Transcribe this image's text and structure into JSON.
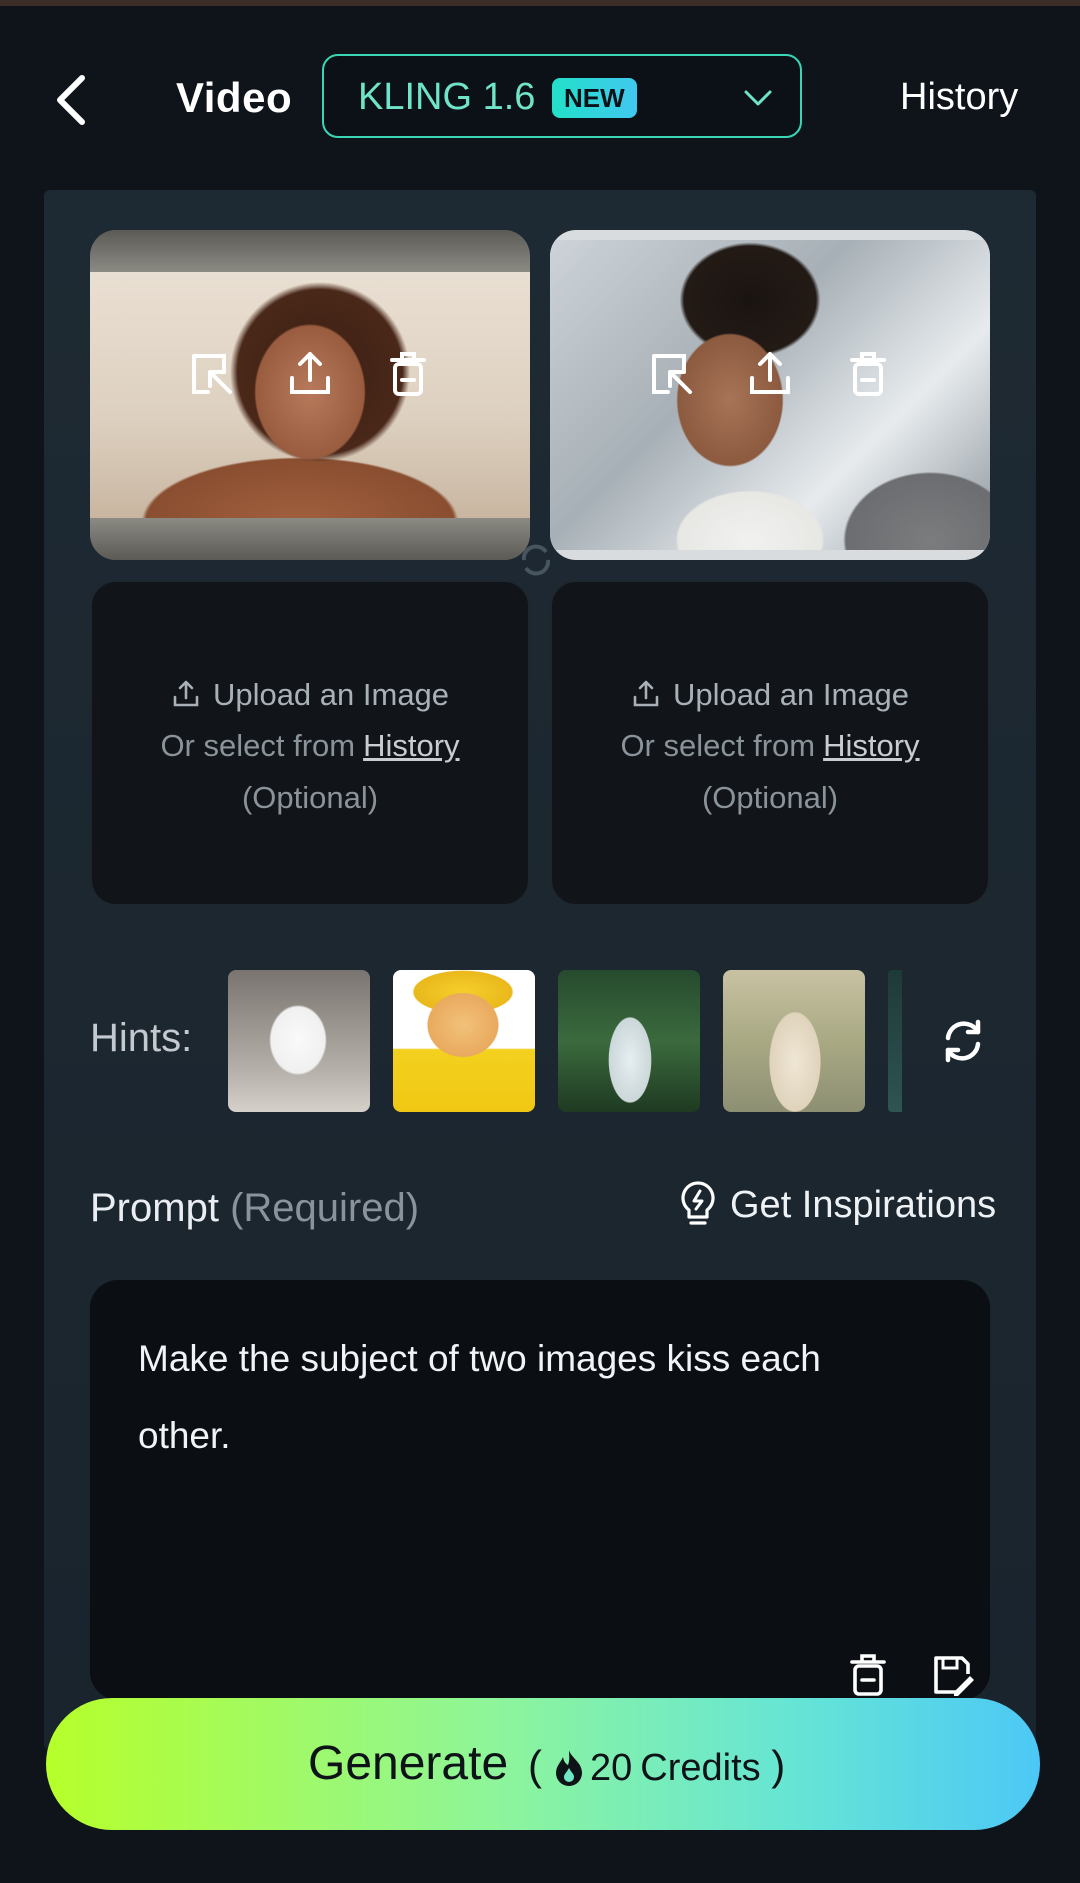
{
  "header": {
    "title": "Video",
    "model": "KLING 1.6",
    "model_badge": "NEW",
    "history_label": "History"
  },
  "slots": {
    "upload_label": "Upload an Image",
    "select_prefix": "Or select from",
    "history_link": "History",
    "optional_label": "(Optional)"
  },
  "hints": {
    "label": "Hints:"
  },
  "prompt": {
    "label": "Prompt",
    "required_label": "(Required)",
    "inspirations_label": "Get Inspirations",
    "text": "Make the subject of two images kiss each other."
  },
  "generate": {
    "label": "Generate",
    "open_paren": "(",
    "credits": "20",
    "credits_unit": "Credits",
    "close_paren": ")"
  },
  "colors": {
    "accent": "#3ad6b3",
    "background": "#0f141b",
    "panel": "#1e2a33",
    "generate_start": "#b6ff2a",
    "generate_end": "#4cc8f6"
  },
  "icons": [
    "back-chevron-icon",
    "chevron-down-icon",
    "select-image-icon",
    "upload-icon",
    "trash-icon",
    "swap-icon",
    "refresh-icon",
    "lightbulb-icon",
    "save-edit-icon",
    "flame-icon"
  ]
}
